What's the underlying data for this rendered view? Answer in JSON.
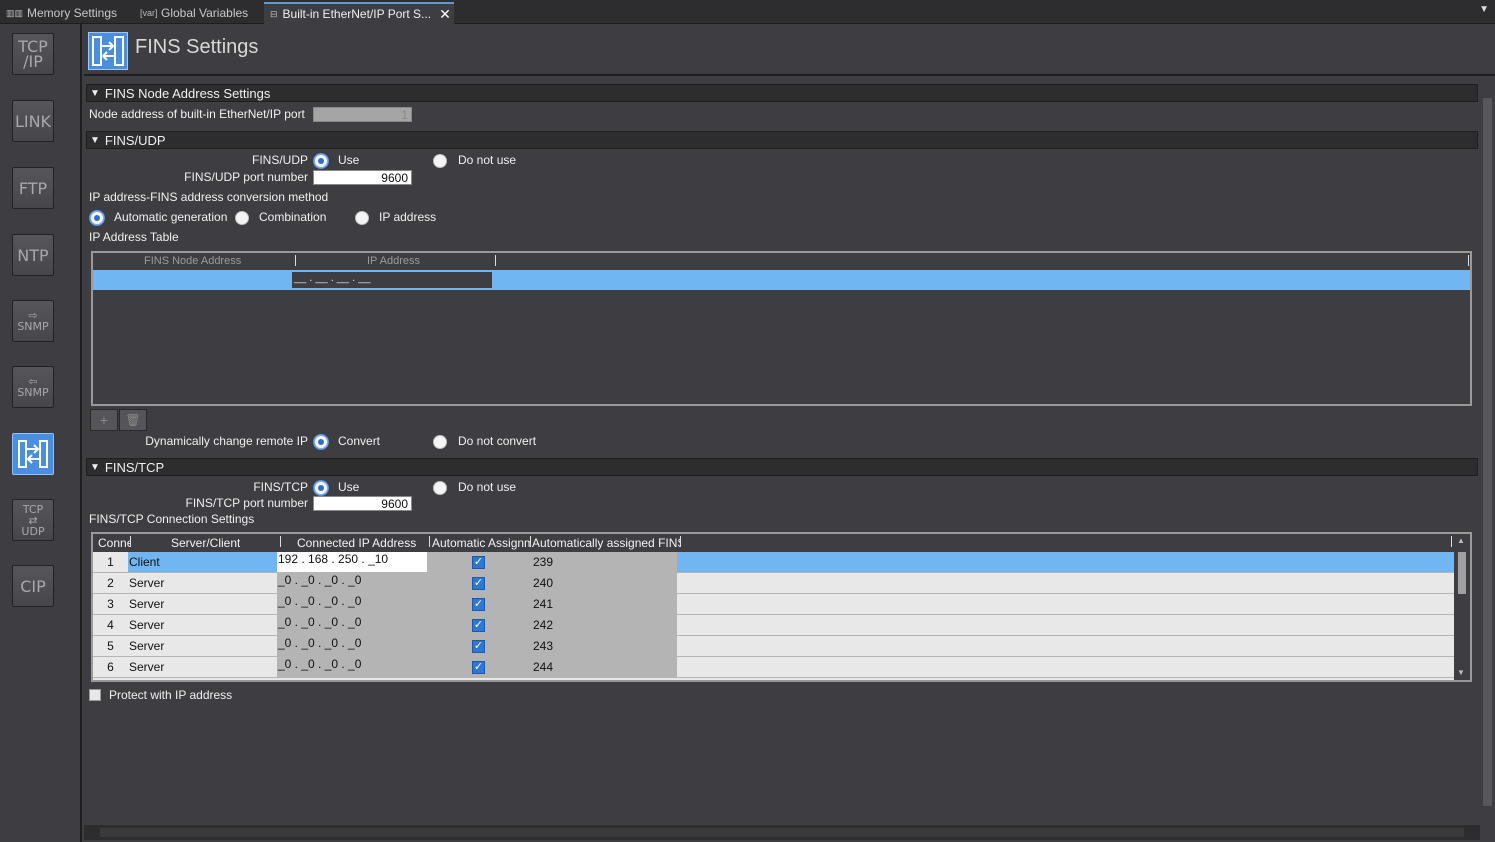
{
  "tabs": [
    {
      "label": "Memory Settings",
      "icon": "memory-icon"
    },
    {
      "label": "Global Variables",
      "icon": "var-icon"
    },
    {
      "label": "Built-in EtherNet/IP Port S...",
      "icon": "ethernet-port-icon",
      "active": true,
      "close": "✕"
    }
  ],
  "tab_icons": {
    "var": "[var]"
  },
  "rail": {
    "tcpip": {
      "line1": "TCP",
      "line2": "/IP"
    },
    "link": "LINK",
    "ftp": "FTP",
    "ntp": "NTP",
    "snmp1": "SNMP",
    "snmp2": "SNMP",
    "tcpudp": {
      "line1": "TCP",
      "line2": "UDP"
    },
    "cip": "CIP"
  },
  "header": {
    "title": "FINS Settings"
  },
  "node_section": {
    "title": "FINS Node Address Settings",
    "node_label": "Node address of built-in EtherNet/IP port",
    "node_value": "1"
  },
  "udp_section": {
    "title": "FINS/UDP",
    "udp_label": "FINS/UDP",
    "use_label": "Use",
    "not_use_label": "Do not use",
    "port_label": "FINS/UDP port number",
    "port_value": "9600",
    "conv_label": "IP address-FINS address conversion method",
    "conv_auto": "Automatic generation",
    "conv_comb": "Combination",
    "conv_ip": "IP address",
    "table_label": "IP Address Table",
    "table_cols": [
      "FINS Node Address",
      "IP Address"
    ],
    "table_row_ip": "__ . __ . __ . __",
    "dyn_label": "Dynamically change remote IP",
    "convert": "Convert",
    "not_convert": "Do not convert",
    "add_btn": "+",
    "del_btn": "🗑"
  },
  "tcp_section": {
    "title": "FINS/TCP",
    "tcp_label": "FINS/TCP",
    "use_label": "Use",
    "not_use_label": "Do not use",
    "port_label": "FINS/TCP port number",
    "port_value": "9600",
    "conn_label": "FINS/TCP Connection Settings",
    "cols": [
      "Conne",
      "Server/Client",
      "Connected IP Address",
      "Automatic Assignm",
      "Automatically assigned FINS"
    ],
    "rows": [
      {
        "num": "1",
        "mode": "Client",
        "ip": "192 . 168 . 250 . _10",
        "auto": true,
        "fins": "239"
      },
      {
        "num": "2",
        "mode": "Server",
        "ip": "_0 . _0 . _0 . _0",
        "auto": true,
        "fins": "240"
      },
      {
        "num": "3",
        "mode": "Server",
        "ip": "_0 . _0 . _0 . _0",
        "auto": true,
        "fins": "241"
      },
      {
        "num": "4",
        "mode": "Server",
        "ip": "_0 . _0 . _0 . _0",
        "auto": true,
        "fins": "242"
      },
      {
        "num": "5",
        "mode": "Server",
        "ip": "_0 . _0 . _0 . _0",
        "auto": true,
        "fins": "243"
      },
      {
        "num": "6",
        "mode": "Server",
        "ip": "_0 . _0 . _0 . _0",
        "auto": true,
        "fins": "244"
      }
    ],
    "protect_label": "Protect with IP address"
  },
  "colors": {
    "accent": "#4a8fdf",
    "selection": "#6fb6f2",
    "panel": "#3e3e42"
  }
}
